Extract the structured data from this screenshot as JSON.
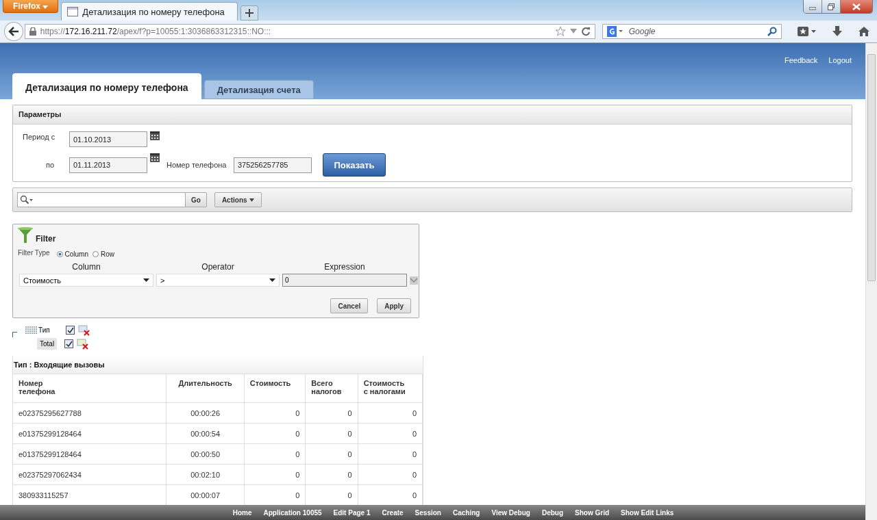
{
  "browser": {
    "menu_button": "Firefox",
    "tabs": [
      {
        "title": "Детализация по номеру телефона",
        "selected": true
      }
    ],
    "url_prefix": "https://",
    "url_host": "172.16.211.72",
    "url_path": "/apex/f?p=10055:1:3036863312315::NO:::",
    "search_placeholder": "Google"
  },
  "header": {
    "links": [
      "Feedback",
      "Logout"
    ]
  },
  "page_tabs": [
    {
      "label": "Детализация по номеру телефона",
      "selected": true
    },
    {
      "label": "Детализация счета",
      "selected": false
    }
  ],
  "parameters": {
    "title": "Параметры",
    "period_from_label": "Период с",
    "period_from": "01.10.2013",
    "period_to_label": "по",
    "period_to": "01.11.2013",
    "phone_label": "Номер телефона",
    "phone": "375256257785",
    "show_button": "Показать"
  },
  "search_bar": {
    "go_button": "Go",
    "actions_button": "Actions"
  },
  "filter": {
    "title": "Filter",
    "type_label": "Filter Type",
    "types": [
      {
        "label": "Column",
        "selected": true
      },
      {
        "label": "Row",
        "selected": false
      }
    ],
    "column_heading": "Column",
    "operator_heading": "Operator",
    "expression_heading": "Expression",
    "column": "Стоимость",
    "operator": ">",
    "expression": "0",
    "cancel_button": "Cancel",
    "apply_button": "Apply"
  },
  "breaks": [
    {
      "label": "Тип",
      "checked": true
    },
    {
      "label": "Total",
      "checked": true
    }
  ],
  "report": {
    "group_title": "Тип : Входящие вызовы",
    "columns": [
      "Номер\nтелефона",
      "Длительность",
      "Стоимость",
      "Всего\nналогов",
      "Стоимость\nс налогами"
    ],
    "rows": [
      [
        "e02375295627788",
        "00:00:26",
        "0",
        "0",
        "0"
      ],
      [
        "e01375299128464",
        "00:00:54",
        "0",
        "0",
        "0"
      ],
      [
        "e01375299128464",
        "00:00:50",
        "0",
        "0",
        "0"
      ],
      [
        "e02375297062434",
        "00:02:10",
        "0",
        "0",
        "0"
      ],
      [
        "380933115257",
        "00:00:07",
        "0",
        "0",
        "0"
      ]
    ]
  },
  "dev_bar": [
    "Home",
    "Application 10055",
    "Edit Page 1",
    "Create",
    "Session",
    "Caching",
    "View Debug",
    "Debug",
    "Show Grid",
    "Show Edit Links"
  ]
}
